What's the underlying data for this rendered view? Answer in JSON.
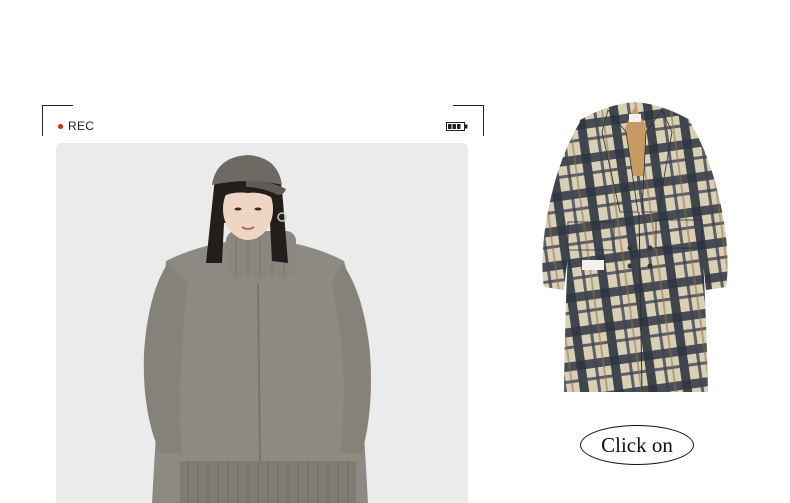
{
  "camera_overlay": {
    "rec_label": "REC",
    "rec_dot_color": "#e02020",
    "battery_icon": "battery-icon"
  },
  "main_photo": {
    "subject": "model-wearing-gray-turtleneck-sweater"
  },
  "product": {
    "image": "plaid-wool-coat"
  },
  "cta": {
    "label": "Click on"
  }
}
